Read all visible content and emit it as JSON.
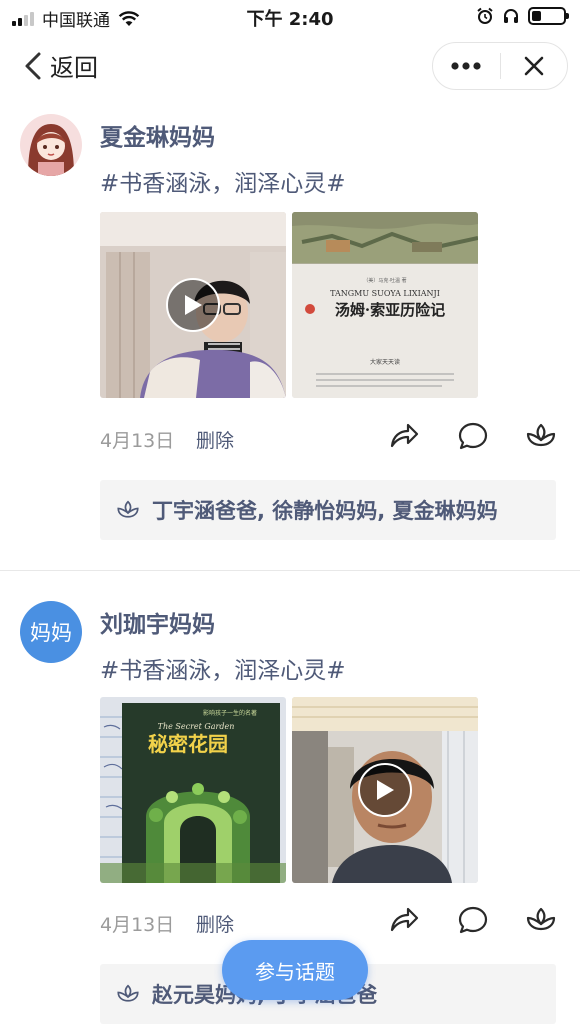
{
  "status_bar": {
    "carrier": "中国联通",
    "time": "下午 2:40",
    "battery_level": 0.3
  },
  "nav": {
    "back_label": "返回"
  },
  "posts": [
    {
      "author": "夏金琳妈妈",
      "topic": "#书香涵泳，润泽心灵#",
      "media": [
        {
          "kind": "video",
          "desc": "girl-reading-video"
        },
        {
          "kind": "image",
          "book_title": "汤姆·索亚历险记",
          "book_pinyin": "TANGMU SUOYA LIXIANJI",
          "book_footer": "大家天天读"
        }
      ],
      "date": "4月13日",
      "delete_label": "删除",
      "likes": "丁宇涵爸爸, 徐静怡妈妈, 夏金琳妈妈"
    },
    {
      "author": "刘珈宇妈妈",
      "avatar_text": "妈妈",
      "topic": "#书香涵泳，润泽心灵#",
      "media": [
        {
          "kind": "image",
          "book_title": "秘密花园",
          "book_en": "The Secret Garden"
        },
        {
          "kind": "video",
          "desc": "boy-reading-video"
        }
      ],
      "date": "4月13日",
      "delete_label": "删除",
      "likes": "赵元昊妈妈, 丁宇涵爸爸"
    }
  ],
  "fab_label": "参与话题",
  "colors": {
    "accent": "#5b9bf0",
    "author": "#4f5a78",
    "muted": "#9b9b9b"
  }
}
